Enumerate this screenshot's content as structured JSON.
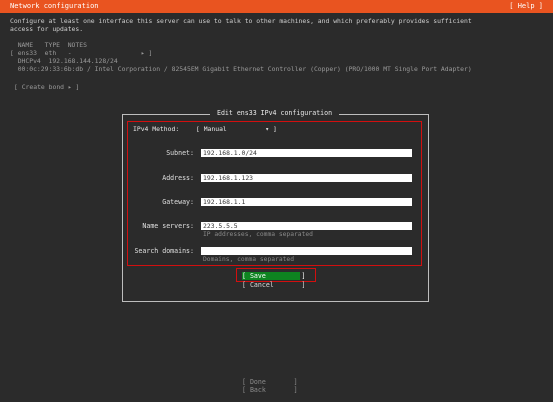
{
  "header": {
    "title": "Network configuration",
    "help": "[ Help ]"
  },
  "intro": [
    "Configure at least one interface this server can use to talk to other machines, and which preferably provides sufficient",
    "access for updates."
  ],
  "iface_table": {
    "headers": "  NAME   TYPE  NOTES",
    "row": "[ ens33  eth   -                  ▸ ]",
    "dhcp": "  DHCPv4  192.168.144.128/24",
    "mac": "  00:0c:29:33:6b:db / Intel Corporation / 82545EM Gigabit Ethernet Controller (Copper) (PRO/1000 MT Single Port Adapter)"
  },
  "create_bond": "[ Create bond ▸ ]",
  "dialog": {
    "title": " Edit ens33 IPv4 configuration ",
    "method_label": "IPv4 Method:",
    "method_value": "[ Manual          ▾ ]",
    "subnet_label": "Subnet:",
    "subnet_value": "192.168.1.0/24",
    "address_label": "Address:",
    "address_value": "192.168.1.123",
    "gateway_label": "Gateway:",
    "gateway_value": "192.168.1.1",
    "ns_label": "Name servers:",
    "ns_value": "223.5.5.5",
    "ns_hint": "IP addresses, comma separated",
    "sd_label": "Search domains:",
    "sd_value": "",
    "sd_hint": "Domains, comma separated",
    "save": "[ Save         ]",
    "cancel": "[ Cancel       ]"
  },
  "footer": {
    "done": "[ Done       ]",
    "back": "[ Back       ]"
  },
  "colors": {
    "header": "#e95420",
    "save": "#0e8420",
    "highlight": "#d20f0f"
  }
}
